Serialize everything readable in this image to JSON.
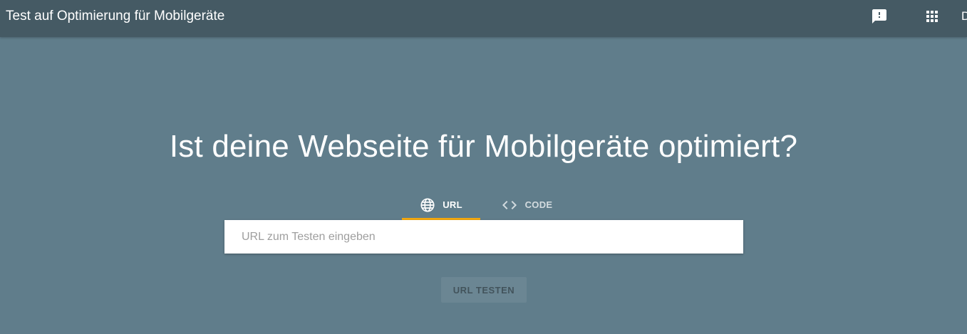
{
  "header": {
    "title": "Test auf Optimierung für Mobilgeräte",
    "feedback_icon": "feedback-icon",
    "apps_icon": "apps-grid-icon",
    "account_initial": "D"
  },
  "main": {
    "headline": "Ist deine Webseite für Mobilgeräte optimiert?",
    "tabs": [
      {
        "label": "URL",
        "icon": "globe-icon",
        "selected": true
      },
      {
        "label": "CODE",
        "icon": "code-icon",
        "selected": false
      }
    ],
    "url_input": {
      "value": "",
      "placeholder": "URL zum Testen eingeben"
    },
    "test_button_label": "URL TESTEN"
  },
  "colors": {
    "header_bg": "#455a64",
    "page_bg": "#607d8b",
    "tab_indicator": "#f4a90f"
  }
}
